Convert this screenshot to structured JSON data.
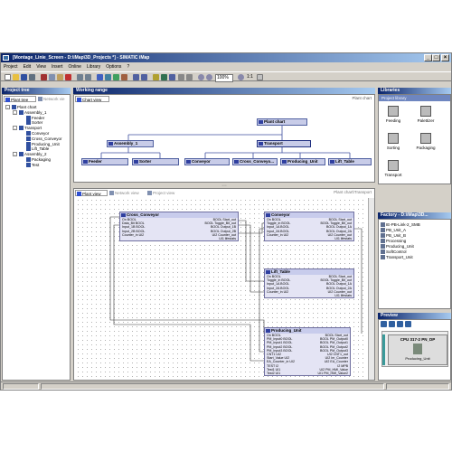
{
  "window": {
    "title": "[Montage_Linie_Screen - D:\\iMap\\3D_Projects *] - SIMATIC iMap"
  },
  "menu": [
    "Project",
    "Edit",
    "View",
    "Insert",
    "Online",
    "Library",
    "Options",
    "?"
  ],
  "toolbar": {
    "zoom": "100%",
    "ratio": "1:1"
  },
  "project_tree": {
    "title": "Project tree",
    "tabs": [
      "Plant tree",
      "Network vie"
    ],
    "items": [
      {
        "label": "Plant chart",
        "level": 0,
        "expander": "-"
      },
      {
        "label": "Assembly_1",
        "level": 1,
        "expander": "-"
      },
      {
        "label": "Feeder",
        "level": 2
      },
      {
        "label": "Sorter",
        "level": 2
      },
      {
        "label": "Transport",
        "level": 1,
        "expander": "-"
      },
      {
        "label": "Conveyor",
        "level": 2
      },
      {
        "label": "Cross_Conveyor",
        "level": 2
      },
      {
        "label": "Producing_Unit",
        "level": 2
      },
      {
        "label": "Lift_Table",
        "level": 2
      },
      {
        "label": "Assembly_2",
        "level": 1,
        "expander": "-"
      },
      {
        "label": "Packaging",
        "level": 2
      },
      {
        "label": "Test",
        "level": 2
      }
    ]
  },
  "working_range": {
    "title": "Working range",
    "chart_tab": "Chart view",
    "chart_link": "Plant chart",
    "chart": {
      "root": "Plant chart",
      "groups": [
        "Assembly_1",
        "Transport"
      ],
      "leaves": [
        "Feeder",
        "Sorter",
        "Conveyor",
        "Cross_Conveyo...",
        "Producing_Unit",
        "Lift_Table"
      ]
    },
    "plant_tabs": [
      "Plant view",
      "Network view",
      "Project view"
    ],
    "plant_link": "Plant chart\\Transport"
  },
  "blocks": {
    "cross_conveyor": {
      "title": "Cross_Conveyor",
      "rows": [
        [
          "On BOOL",
          "BOOL Start_out"
        ],
        [
          "Data_Bit BOOL",
          "BOOL Toggle_Bit_out"
        ],
        [
          "Input_1B BOOL",
          "BOOL Output_1B"
        ],
        [
          "Input_2B BOOL",
          "BOOL Output_2B"
        ],
        [
          "Counter_in UI2",
          "UI2 Counter_out"
        ],
        [
          "",
          "UI1 lifestats"
        ]
      ]
    },
    "conveyor": {
      "title": "Conveyor",
      "rows": [
        [
          "On BOOL",
          "BOOL Start_out"
        ],
        [
          "Toggle_in BOOL",
          "BOOL Toggle_Bit_out"
        ],
        [
          "Input_1A BOOL",
          "BOOL Output_1A"
        ],
        [
          "Input_2A BOOL",
          "BOOL Output_2A"
        ],
        [
          "Counter_in UI2",
          "UI2 Counter_out"
        ],
        [
          "",
          "UI1 lifestats"
        ]
      ]
    },
    "lift_table": {
      "title": "Lift_Table",
      "rows": [
        [
          "On BOOL",
          "BOOL Start_out"
        ],
        [
          "Toggle_in BOOL",
          "BOOL Toggle_Bit_out"
        ],
        [
          "Input_1A BOOL",
          "BOOL Output_1A"
        ],
        [
          "Input_2A BOOL",
          "BOOL Output_2A"
        ],
        [
          "Counter_in UI2",
          "UI2 Counter_out"
        ],
        [
          "",
          "UI1 lifestats"
        ]
      ]
    },
    "producing_unit": {
      "title": "Producing_Unit",
      "rows": [
        [
          "On BOOL",
          "BOOL Start_out"
        ],
        [
          "PM_Input0 BOOL",
          "BOOL PM_Output0"
        ],
        [
          "PM_Input1 BOOL",
          "BOOL PM_Output1"
        ],
        [
          "PM_Input2 BOOL",
          "BOOL PM_Output2"
        ],
        [
          "PM_Input3 BOOL",
          "BOOL PM_Output3"
        ],
        [
          "CNT1 UI2",
          "UI2 CNT1_out"
        ],
        [
          "Start_Value UI2",
          "UI2 Im_Counter"
        ],
        [
          "EA_Counter_in UI2",
          "UI2 EA_Counter"
        ],
        [
          "TEST I2",
          "I2 MPB"
        ],
        [
          "Test1 UI1",
          "UI2 PM_HMI_Value"
        ],
        [
          "Test2 UI1",
          "UI1 PM_HMI_Value2"
        ]
      ]
    }
  },
  "libraries": {
    "title": "Libraries",
    "section": "Project library",
    "items": [
      "Feeding",
      "Palettizer",
      "Sorting",
      "Packaging",
      "Transport"
    ]
  },
  "factory": {
    "title": "Factory - D:\\iMap\\3D...",
    "items": [
      "IE-PB-Link-2_SMB",
      "PB_Unit_A",
      "PB_Unit_B",
      "Processing",
      "Producing_Unit",
      "SoftControl",
      "Transport_Unit"
    ]
  },
  "preview": {
    "title": "Preview",
    "device": "CPU 317-2 PN_DP",
    "device_label": "Producing_Unit"
  },
  "colors": {
    "title_bar": "#0a246a",
    "block_header": "#c8ccec",
    "chart_box": "#c8cce8"
  }
}
